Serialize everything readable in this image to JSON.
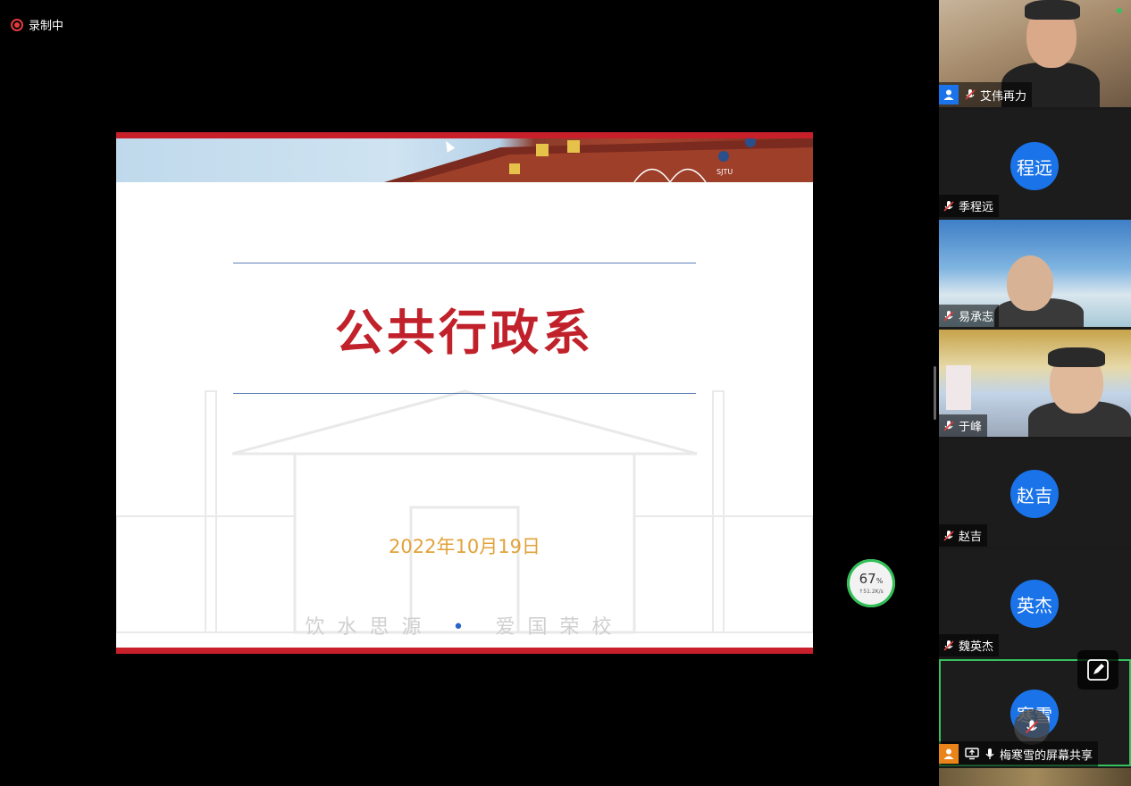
{
  "recording": {
    "label": "录制中",
    "color": "#e23b3b"
  },
  "slide": {
    "title": "公共行政系",
    "date": "2022年10月19日",
    "motto_left": "饮水思源",
    "motto_separator": "•",
    "motto_right": "爱国荣校",
    "banner_text": "SJTU",
    "accent": "#c8202a"
  },
  "network": {
    "percent": "67",
    "percent_unit": "%",
    "speed": "↑51.2K/s"
  },
  "participants": [
    {
      "name": "艾伟再力",
      "type": "video",
      "mic": "muted",
      "badge": "person-icon"
    },
    {
      "name": "季程远",
      "type": "avatar",
      "avatar_text": "程远",
      "mic": "muted"
    },
    {
      "name": "易承志",
      "type": "video",
      "mic": "muted"
    },
    {
      "name": "于峰",
      "type": "video",
      "mic": "muted"
    },
    {
      "name": "赵吉",
      "type": "avatar",
      "avatar_text": "赵吉",
      "mic": "muted"
    },
    {
      "name": "魏英杰",
      "type": "avatar",
      "avatar_text": "英杰",
      "mic": "muted"
    },
    {
      "name": "梅寒雪的屏幕共享",
      "type": "avatar",
      "avatar_text": "寒雪",
      "mic": "on",
      "active": true
    }
  ],
  "colors": {
    "avatar_bg": "#1a73e8",
    "active_border": "#35c25d"
  }
}
